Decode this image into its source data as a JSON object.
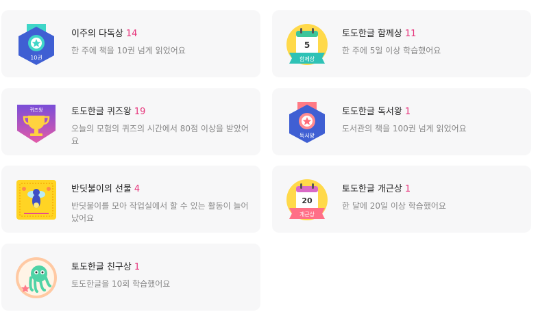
{
  "badges": [
    {
      "title": "이주의 다독상",
      "count": "14",
      "desc": "한 주에 책을 10권 넘게 읽었어요",
      "icon": "10-books-badge-icon",
      "badge_text": "10권"
    },
    {
      "title": "토도한글 함께상",
      "count": "11",
      "desc": "한 주에 5일 이상 학습했어요",
      "icon": "calendar-together-badge-icon",
      "badge_text": "함께상",
      "badge_num": "5"
    },
    {
      "title": "토도한글 퀴즈왕",
      "count": "19",
      "desc": "오늘의 모험의 퀴즈의 시간에서 80점 이상을 받았어요",
      "icon": "quiz-king-trophy-badge-icon",
      "badge_text": "퀴즈왕"
    },
    {
      "title": "토도한글 독서왕",
      "count": "1",
      "desc": "도서관의 책을 100권 넘게 읽었어요",
      "icon": "reading-king-medal-badge-icon",
      "badge_text": "독서왕"
    },
    {
      "title": "반딧불이의 선물",
      "count": "4",
      "desc": "반딧불이를 모아 작업실에서 할 수 있는 활동이 늘어났어요",
      "icon": "firefly-gift-badge-icon"
    },
    {
      "title": "토도한글 개근상",
      "count": "1",
      "desc": "한 달에 20일 이상 학습했어요",
      "icon": "calendar-attendance-badge-icon",
      "badge_text": "개근상",
      "badge_num": "20"
    },
    {
      "title": "토도한글 친구상",
      "count": "1",
      "desc": "토도한글을 10회 학습했어요",
      "icon": "friend-octopus-badge-icon"
    }
  ],
  "colors": {
    "count": "#e6337a",
    "card_bg": "#f7f7f8"
  }
}
